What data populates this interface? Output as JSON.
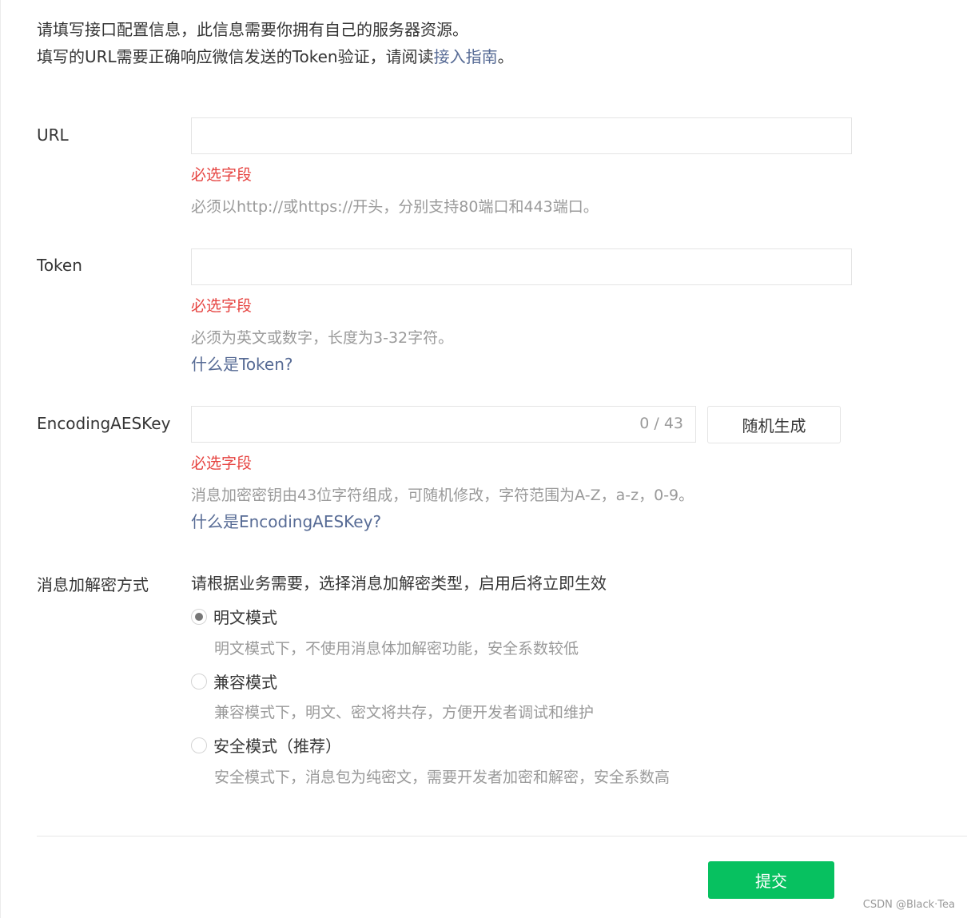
{
  "intro": {
    "line1": "请填写接口配置信息，此信息需要你拥有自己的服务器资源。",
    "line2_prefix": "填写的URL需要正确响应微信发送的Token验证，请阅读",
    "line2_link": "接入指南",
    "line2_suffix": "。"
  },
  "url": {
    "label": "URL",
    "value": "",
    "error": "必选字段",
    "tip": "必须以http://或https://开头，分别支持80端口和443端口。"
  },
  "token": {
    "label": "Token",
    "value": "",
    "error": "必选字段",
    "tip": "必须为英文或数字，长度为3-32字符。",
    "help": "什么是Token?"
  },
  "aeskey": {
    "label": "EncodingAESKey",
    "value": "",
    "counter": "0 / 43",
    "random_button": "随机生成",
    "error": "必选字段",
    "tip": "消息加密密钥由43位字符组成，可随机修改，字符范围为A-Z，a-z，0-9。",
    "help": "什么是EncodingAESKey?"
  },
  "encryption": {
    "label": "消息加解密方式",
    "description": "请根据业务需要，选择消息加解密类型，启用后将立即生效",
    "options": [
      {
        "label": "明文模式",
        "tip": "明文模式下，不使用消息体加解密功能，安全系数较低",
        "checked": true
      },
      {
        "label": "兼容模式",
        "tip": "兼容模式下，明文、密文将共存，方便开发者调试和维护",
        "checked": false
      },
      {
        "label": "安全模式（推荐）",
        "tip": "安全模式下，消息包为纯密文，需要开发者加密和解密，安全系数高",
        "checked": false
      }
    ]
  },
  "submit_label": "提交",
  "watermark": "CSDN @Black·Tea",
  "colors": {
    "link": "#576b95",
    "error": "#e64340",
    "primary": "#07c160"
  }
}
